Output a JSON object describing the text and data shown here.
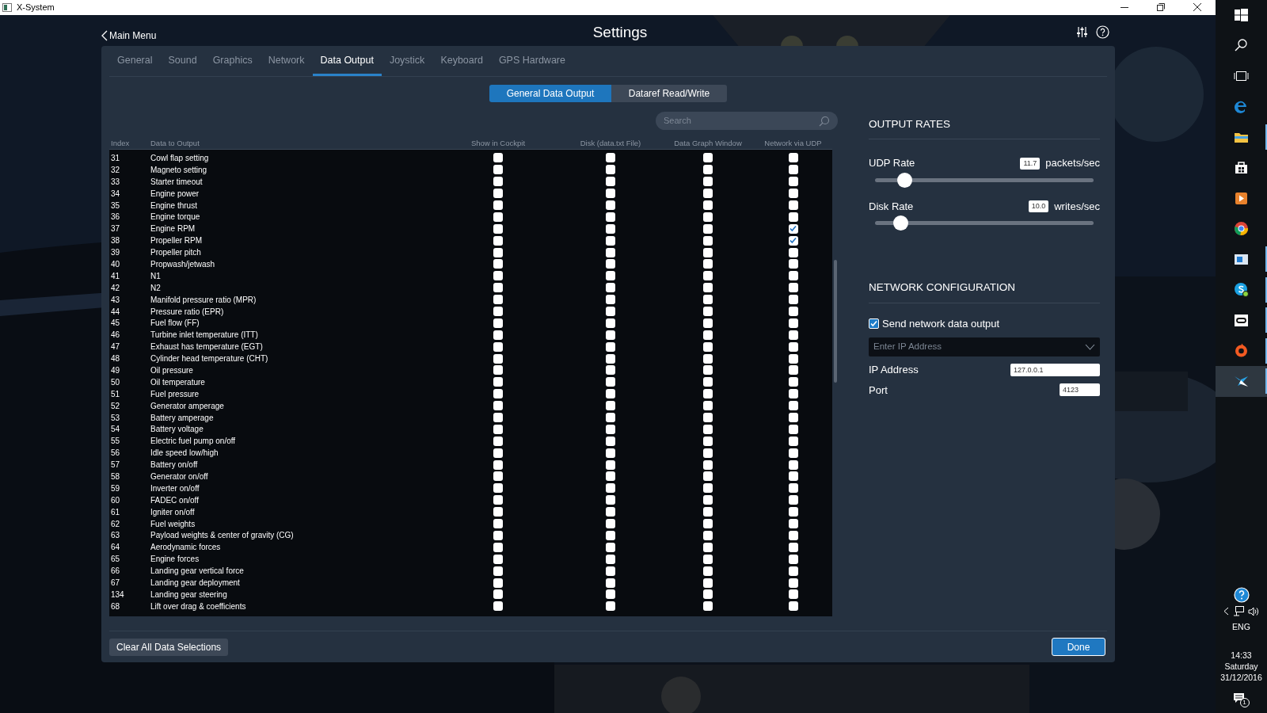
{
  "window": {
    "title": "X-System"
  },
  "header": {
    "back": "Main Menu",
    "title": "Settings"
  },
  "tabs": [
    {
      "label": "General",
      "selected": false
    },
    {
      "label": "Sound",
      "selected": false
    },
    {
      "label": "Graphics",
      "selected": false
    },
    {
      "label": "Network",
      "selected": false
    },
    {
      "label": "Data Output",
      "selected": true
    },
    {
      "label": "Joystick",
      "selected": false
    },
    {
      "label": "Keyboard",
      "selected": false
    },
    {
      "label": "GPS Hardware",
      "selected": false
    }
  ],
  "subtabs": [
    {
      "label": "General Data Output",
      "selected": true
    },
    {
      "label": "Dataref Read/Write",
      "selected": false
    }
  ],
  "search": {
    "placeholder": "Search"
  },
  "table": {
    "columns": [
      "Index",
      "Data to Output",
      "Show in Cockpit",
      "Disk (data.txt File)",
      "Data Graph Window",
      "Network via UDP"
    ],
    "rows": [
      {
        "index": "31",
        "name": "Cowl flap setting",
        "checks": [
          false,
          false,
          false,
          false
        ]
      },
      {
        "index": "32",
        "name": "Magneto setting",
        "checks": [
          false,
          false,
          false,
          false
        ]
      },
      {
        "index": "33",
        "name": "Starter timeout",
        "checks": [
          false,
          false,
          false,
          false
        ]
      },
      {
        "index": "34",
        "name": "Engine power",
        "checks": [
          false,
          false,
          false,
          false
        ]
      },
      {
        "index": "35",
        "name": "Engine thrust",
        "checks": [
          false,
          false,
          false,
          false
        ]
      },
      {
        "index": "36",
        "name": "Engine torque",
        "checks": [
          false,
          false,
          false,
          false
        ]
      },
      {
        "index": "37",
        "name": "Engine RPM",
        "checks": [
          false,
          false,
          false,
          true
        ]
      },
      {
        "index": "38",
        "name": "Propeller RPM",
        "checks": [
          false,
          false,
          false,
          true
        ]
      },
      {
        "index": "39",
        "name": "Propeller pitch",
        "checks": [
          false,
          false,
          false,
          false
        ]
      },
      {
        "index": "40",
        "name": "Propwash/jetwash",
        "checks": [
          false,
          false,
          false,
          false
        ]
      },
      {
        "index": "41",
        "name": "N1",
        "checks": [
          false,
          false,
          false,
          false
        ]
      },
      {
        "index": "42",
        "name": "N2",
        "checks": [
          false,
          false,
          false,
          false
        ]
      },
      {
        "index": "43",
        "name": "Manifold pressure ratio (MPR)",
        "checks": [
          false,
          false,
          false,
          false
        ]
      },
      {
        "index": "44",
        "name": "Pressure ratio (EPR)",
        "checks": [
          false,
          false,
          false,
          false
        ]
      },
      {
        "index": "45",
        "name": "Fuel flow (FF)",
        "checks": [
          false,
          false,
          false,
          false
        ]
      },
      {
        "index": "46",
        "name": "Turbine inlet temperature (ITT)",
        "checks": [
          false,
          false,
          false,
          false
        ]
      },
      {
        "index": "47",
        "name": "Exhaust has temperature (EGT)",
        "checks": [
          false,
          false,
          false,
          false
        ]
      },
      {
        "index": "48",
        "name": "Cylinder head temperature (CHT)",
        "checks": [
          false,
          false,
          false,
          false
        ]
      },
      {
        "index": "49",
        "name": "Oil pressure",
        "checks": [
          false,
          false,
          false,
          false
        ]
      },
      {
        "index": "50",
        "name": "Oil temperature",
        "checks": [
          false,
          false,
          false,
          false
        ]
      },
      {
        "index": "51",
        "name": "Fuel pressure",
        "checks": [
          false,
          false,
          false,
          false
        ]
      },
      {
        "index": "52",
        "name": "Generator amperage",
        "checks": [
          false,
          false,
          false,
          false
        ]
      },
      {
        "index": "53",
        "name": "Battery amperage",
        "checks": [
          false,
          false,
          false,
          false
        ]
      },
      {
        "index": "54",
        "name": "Battery voltage",
        "checks": [
          false,
          false,
          false,
          false
        ]
      },
      {
        "index": "55",
        "name": "Electric fuel pump on/off",
        "checks": [
          false,
          false,
          false,
          false
        ]
      },
      {
        "index": "56",
        "name": "Idle speed low/high",
        "checks": [
          false,
          false,
          false,
          false
        ]
      },
      {
        "index": "57",
        "name": "Battery on/off",
        "checks": [
          false,
          false,
          false,
          false
        ]
      },
      {
        "index": "58",
        "name": "Generator on/off",
        "checks": [
          false,
          false,
          false,
          false
        ]
      },
      {
        "index": "59",
        "name": "Inverter on/off",
        "checks": [
          false,
          false,
          false,
          false
        ]
      },
      {
        "index": "60",
        "name": "FADEC on/off",
        "checks": [
          false,
          false,
          false,
          false
        ]
      },
      {
        "index": "61",
        "name": "Igniter on/off",
        "checks": [
          false,
          false,
          false,
          false
        ]
      },
      {
        "index": "62",
        "name": "Fuel weights",
        "checks": [
          false,
          false,
          false,
          false
        ]
      },
      {
        "index": "63",
        "name": "Payload weights & center of gravity (CG)",
        "checks": [
          false,
          false,
          false,
          false
        ]
      },
      {
        "index": "64",
        "name": "Aerodynamic forces",
        "checks": [
          false,
          false,
          false,
          false
        ]
      },
      {
        "index": "65",
        "name": "Engine forces",
        "checks": [
          false,
          false,
          false,
          false
        ]
      },
      {
        "index": "66",
        "name": "Landing gear vertical force",
        "checks": [
          false,
          false,
          false,
          false
        ]
      },
      {
        "index": "67",
        "name": "Landing gear deployment",
        "checks": [
          false,
          false,
          false,
          false
        ]
      },
      {
        "index": "134",
        "name": "Landing gear steering",
        "checks": [
          false,
          false,
          false,
          false
        ]
      },
      {
        "index": "68",
        "name": "Lift over drag & coefficients",
        "checks": [
          false,
          false,
          false,
          false
        ]
      }
    ]
  },
  "output_rates": {
    "title": "OUTPUT RATES",
    "rates": [
      {
        "label": "UDP Rate",
        "value": "11.7",
        "unit": "packets/sec",
        "level": 0.11
      },
      {
        "label": "Disk Rate",
        "value": "10.0",
        "unit": "writes/sec",
        "level": 0.09
      }
    ]
  },
  "network": {
    "title": "NETWORK CONFIGURATION",
    "send": {
      "label": "Send network data output",
      "checked": true
    },
    "ip_select": {
      "placeholder": "Enter IP Address"
    },
    "fields": [
      {
        "label": "IP Address",
        "value": "127.0.0.1"
      },
      {
        "label": "Port",
        "value": "4123"
      }
    ]
  },
  "footer": {
    "clear": "Clear All Data Selections",
    "done": "Done"
  },
  "taskbar": {
    "apps": [
      {
        "kind": "start",
        "running": false,
        "selected": false
      },
      {
        "kind": "search",
        "running": false,
        "selected": false
      },
      {
        "kind": "taskview",
        "running": false,
        "selected": false
      },
      {
        "kind": "edge",
        "running": false,
        "selected": false
      },
      {
        "kind": "explorer",
        "running": true,
        "selected": false
      },
      {
        "kind": "store",
        "running": false,
        "selected": false
      },
      {
        "kind": "media",
        "running": false,
        "selected": false
      },
      {
        "kind": "chrome",
        "running": false,
        "selected": false
      },
      {
        "kind": "window",
        "running": true,
        "selected": false
      },
      {
        "kind": "skype",
        "running": true,
        "selected": false
      },
      {
        "kind": "oculus",
        "running": true,
        "selected": false
      },
      {
        "kind": "origin",
        "running": true,
        "selected": false
      },
      {
        "kind": "xplane",
        "running": true,
        "selected": true
      }
    ],
    "language": "ENG",
    "time": "14:33",
    "day": "Saturday",
    "date": "31/12/2016",
    "notifications": "1"
  }
}
